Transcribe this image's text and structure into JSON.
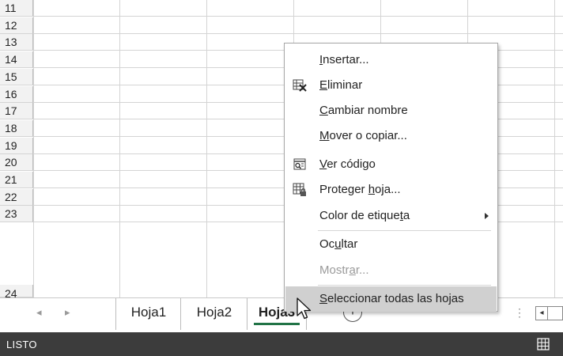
{
  "grid": {
    "row_numbers": [
      "11",
      "12",
      "13",
      "14",
      "15",
      "16",
      "17",
      "18",
      "19",
      "20",
      "21",
      "22",
      "23",
      "24"
    ]
  },
  "sheet_tabs": [
    {
      "label": "Hoja1",
      "active": false
    },
    {
      "label": "Hoja2",
      "active": false
    },
    {
      "label": "Hoja3",
      "active": true
    }
  ],
  "tabbar": {
    "new_sheet_glyph": "+",
    "prev_arrow": "◂",
    "next_arrow": "▸",
    "scroll_left_glyph": "◂",
    "split_glyph": "⋮"
  },
  "status_bar": {
    "status_text": "LISTO",
    "view_icon": "normal-view-icon"
  },
  "context_menu": {
    "items": [
      {
        "pre": "",
        "key": "I",
        "post": "nsertar...",
        "icon": "",
        "disabled": false
      },
      {
        "pre": "",
        "key": "E",
        "post": "liminar",
        "icon": "delete-sheet-icon",
        "disabled": false
      },
      {
        "pre": "",
        "key": "C",
        "post": "ambiar nombre",
        "icon": "",
        "disabled": false
      },
      {
        "pre": "",
        "key": "M",
        "post": "over o copiar...",
        "icon": "",
        "disabled": false
      },
      {
        "pre": "",
        "key": "V",
        "post": "er código",
        "icon": "view-code-icon",
        "disabled": false
      },
      {
        "pre": "Proteger ",
        "key": "h",
        "post": "oja...",
        "icon": "protect-sheet-icon",
        "disabled": false
      },
      {
        "pre": "Color de etique",
        "key": "t",
        "post": "a",
        "icon": "",
        "disabled": false,
        "submenu": true
      },
      {
        "pre": "Oc",
        "key": "u",
        "post": "ltar",
        "icon": "",
        "disabled": false
      },
      {
        "pre": "Mostr",
        "key": "a",
        "post": "r...",
        "icon": "",
        "disabled": true
      },
      {
        "pre": "",
        "key": "S",
        "post": "eleccionar todas las hojas",
        "icon": "",
        "disabled": false,
        "highlighted": true
      }
    ]
  },
  "colors": {
    "accent": "#217346",
    "status_bar_bg": "#3c3c3c",
    "menu_highlight": "#d0d0d0"
  }
}
